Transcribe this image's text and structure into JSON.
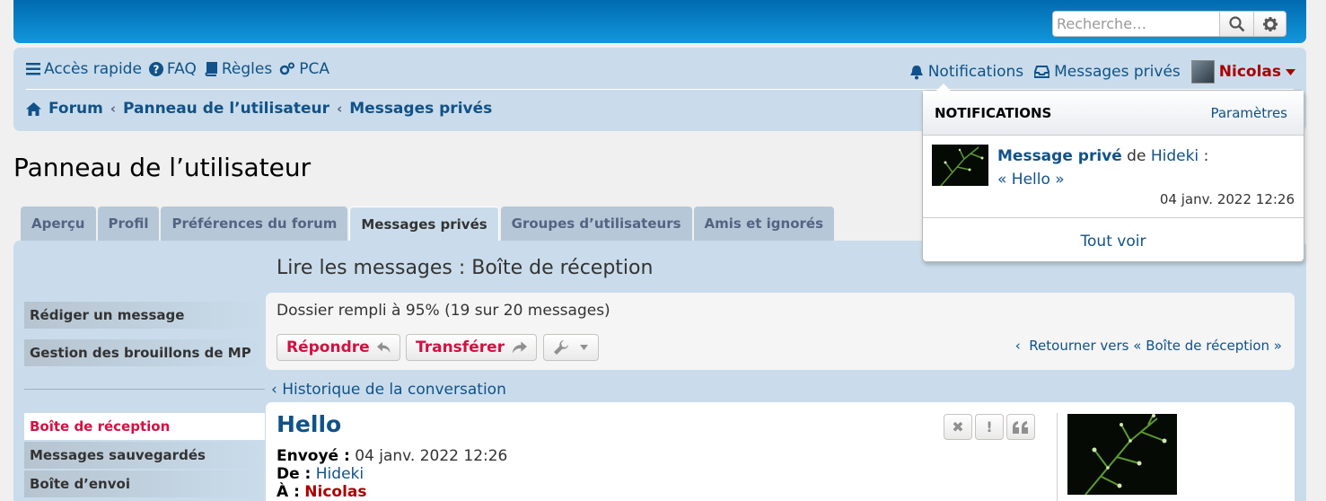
{
  "search": {
    "placeholder": "Recherche…"
  },
  "nav": {
    "quick_access": "Accès rapide",
    "faq": "FAQ",
    "rules": "Règles",
    "acp": "PCA",
    "notifications": "Notifications",
    "private_messages": "Messages privés",
    "username": "Nicolas"
  },
  "breadcrumbs": [
    "Forum",
    "Panneau de l’utilisateur",
    "Messages privés"
  ],
  "page_title": "Panneau de l’utilisateur",
  "tabs": [
    "Aperçu",
    "Profil",
    "Préférences du forum",
    "Messages privés",
    "Groupes d’utilisateurs",
    "Amis et ignorés"
  ],
  "sidebar": {
    "compose": "Rédiger un message",
    "drafts": "Gestion des brouillons de MP",
    "folders": [
      "Boîte de réception",
      "Messages sauvegardés",
      "Boîte d’envoi"
    ]
  },
  "section_title": "Lire les messages : Boîte de réception",
  "folder_status": "Dossier rempli à 95% (19 sur 20 messages)",
  "actions": {
    "reply": "Répondre",
    "forward": "Transférer",
    "return_link": "Retourner vers « Boîte de réception »"
  },
  "history_link": "Historique de la conversation",
  "post": {
    "title": "Hello",
    "sent_label": "Envoyé :",
    "sent_value": "04 janv. 2022 12:26",
    "from_label": "De :",
    "from_value": "Hideki",
    "to_label": "À :",
    "to_value": "Nicolas"
  },
  "notifications": {
    "header": "NOTIFICATIONS",
    "settings": "Paramètres",
    "item_type": "Message privé",
    "item_from": "de",
    "item_user": "Hideki",
    "item_colon": ":",
    "item_subject": "« Hello »",
    "item_time": "04 janv. 2022 12:26",
    "see_all": "Tout voir"
  },
  "colors": {
    "accent": "#105289",
    "header": "#0076b3",
    "panel": "#cadceb",
    "danger": "#d31141",
    "username": "#aa0000"
  }
}
